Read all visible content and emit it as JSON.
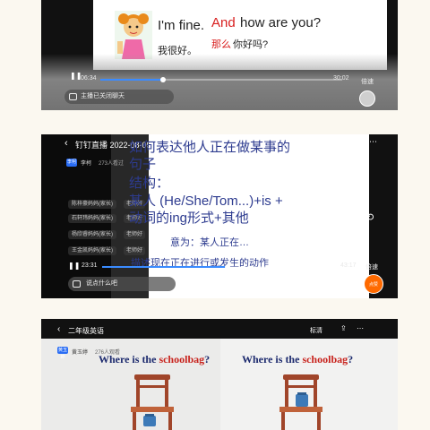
{
  "shot1": {
    "slide": {
      "line1_en": "I'm fine.",
      "line1_zh": "我很好。",
      "line2_en_red": "And",
      "line2_en_black": "how are you?",
      "line2_zh_red": "那么",
      "line2_zh_black": "你好吗?"
    },
    "player": {
      "current_time": "06:34",
      "total_time": "30:02",
      "progress": 0.26,
      "chat_placeholder": "主播已关闭聊天",
      "speed_label": "倍速"
    }
  },
  "shot2": {
    "header_title": "钉钉直播 2022-08-05",
    "host_badge": "李柯",
    "host_name": "李柯",
    "watch_count": "273人看过",
    "chat_rows": [
      {
        "name": "陈梓豪妈妈(家长)",
        "tag": "老师好"
      },
      {
        "name": "石轩玮妈妈(家长)",
        "tag": "老师好"
      },
      {
        "name": "杨欣睿妈妈(家长)",
        "tag": "老师好"
      },
      {
        "name": "王金凯妈妈(家长)",
        "tag": "老师好"
      }
    ],
    "slide": {
      "title_line1": "如何表达他人正在做某事的",
      "title_line2": "句子",
      "structure_label": "结构：",
      "structure_line1": "某人 (He/She/Tom...)+is +",
      "structure_line2": "动词的ing形式+其他",
      "meaning": "意为：某人正在…",
      "description": "描述现在正在进行或发生的动作"
    },
    "player": {
      "current_time": "23:31",
      "total_time": "43:17",
      "progress": 0.54,
      "chat_placeholder": "说点什么吧",
      "speed_label": "倍速",
      "like_button": "点赞"
    }
  },
  "shot3": {
    "header_title": "二年级英语",
    "hd_label": "标清",
    "host_badge": "黄玉婷",
    "host_name": "黄玉婷",
    "watch_count": "276人观看",
    "question_left": {
      "prefix": "Where is the ",
      "highlight": "schoolbag",
      "suffix": "?"
    },
    "question_right": {
      "prefix": "Where is the ",
      "highlight": "schoolbag",
      "suffix": "?"
    }
  },
  "colors": {
    "accent_blue": "#2a6df4",
    "slide_red": "#d81e1e",
    "slide_navy": "#2d3b8f",
    "orange_button": "#ff6a00",
    "background": "#fbf8f0"
  },
  "icons": [
    "back-chevron-icon",
    "rotate-icon",
    "play-pause-icon",
    "fullscreen-icon",
    "chat-icon",
    "share-icon",
    "more-icon"
  ]
}
